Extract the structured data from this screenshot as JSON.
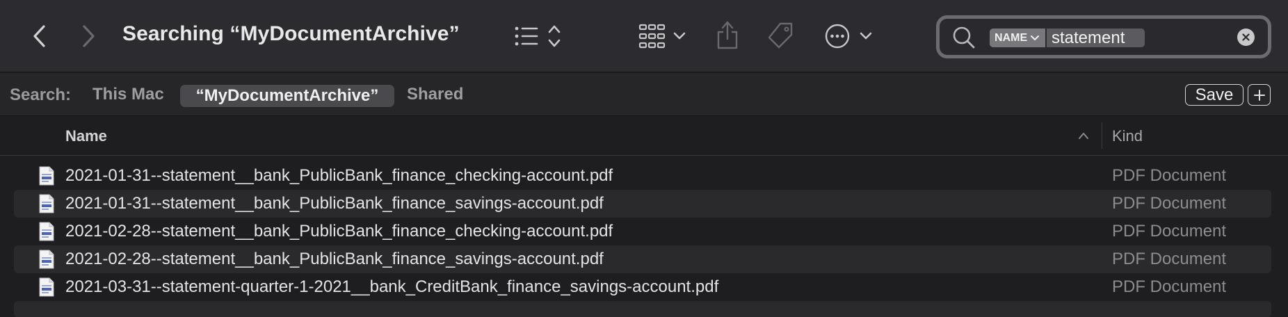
{
  "window": {
    "title": "Searching “MyDocumentArchive”"
  },
  "toolbar": {
    "back_icon": "chevron-left-icon",
    "forward_icon": "chevron-right-icon",
    "view_list_icon": "list-view-icon",
    "group_icon": "group-grid-icon",
    "share_icon": "share-icon",
    "tag_icon": "tag-icon",
    "more_icon": "ellipsis-circle-icon"
  },
  "search": {
    "token_label": "NAME",
    "token_value": "statement",
    "icon": "search-icon",
    "clear_icon": "clear-icon"
  },
  "scope": {
    "label": "Search:",
    "options": [
      "This Mac",
      "“MyDocumentArchive”",
      "Shared"
    ],
    "selected": "“MyDocumentArchive”",
    "save_label": "Save",
    "add_label": "+"
  },
  "columns": {
    "name": "Name",
    "kind": "Kind",
    "sort": "ascending"
  },
  "files": [
    {
      "name": "2021-01-31--statement__bank_PublicBank_finance_checking-account.pdf",
      "kind": "PDF Document"
    },
    {
      "name": "2021-01-31--statement__bank_PublicBank_finance_savings-account.pdf",
      "kind": "PDF Document"
    },
    {
      "name": "2021-02-28--statement__bank_PublicBank_finance_checking-account.pdf",
      "kind": "PDF Document"
    },
    {
      "name": "2021-02-28--statement__bank_PublicBank_finance_savings-account.pdf",
      "kind": "PDF Document"
    },
    {
      "name": "2021-03-31--statement-quarter-1-2021__bank_CreditBank_finance_savings-account.pdf",
      "kind": "PDF Document"
    }
  ],
  "colors": {
    "toolbar_bg": "#2c2b2f",
    "window_bg": "#1e1e20",
    "selected_scope_bg": "#4a4a4e"
  }
}
